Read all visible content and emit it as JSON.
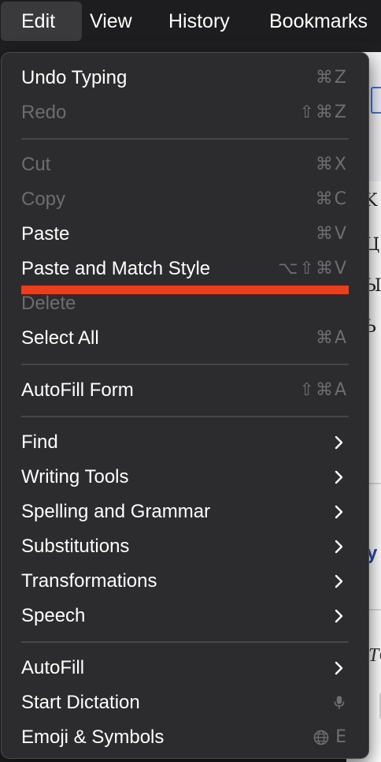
{
  "menubar": {
    "items": [
      {
        "label": "Edit",
        "active": true
      },
      {
        "label": "View"
      },
      {
        "label": "History"
      },
      {
        "label": "Bookmarks"
      }
    ]
  },
  "menu": {
    "items": [
      {
        "label": "Undo Typing",
        "shortcut": "⌘Z",
        "enabled": true
      },
      {
        "label": "Redo",
        "shortcut": "⇧⌘Z",
        "enabled": false
      },
      {
        "label": "Cut",
        "shortcut": "⌘X",
        "enabled": false
      },
      {
        "label": "Copy",
        "shortcut": "⌘C",
        "enabled": false
      },
      {
        "label": "Paste",
        "shortcut": "⌘V",
        "enabled": true
      },
      {
        "label": "Paste and Match Style",
        "shortcut": "⌥⇧⌘V",
        "enabled": true,
        "annotated": true
      },
      {
        "label": "Delete",
        "shortcut": "",
        "enabled": false
      },
      {
        "label": "Select All",
        "shortcut": "⌘A",
        "enabled": true
      },
      {
        "label": "AutoFill Form",
        "shortcut": "⇧⌘A",
        "enabled": true
      },
      {
        "label": "Find",
        "submenu": true,
        "enabled": true
      },
      {
        "label": "Writing Tools",
        "submenu": true,
        "enabled": true
      },
      {
        "label": "Spelling and Grammar",
        "submenu": true,
        "enabled": true
      },
      {
        "label": "Substitutions",
        "submenu": true,
        "enabled": true
      },
      {
        "label": "Transformations",
        "submenu": true,
        "enabled": true
      },
      {
        "label": "Speech",
        "submenu": true,
        "enabled": true
      },
      {
        "label": "AutoFill",
        "submenu": true,
        "enabled": true
      },
      {
        "label": "Start Dictation",
        "shortcut_icon": "microphone-icon",
        "enabled": true
      },
      {
        "label": "Emoji & Symbols",
        "shortcut": "E",
        "shortcut_icon": "globe-icon",
        "enabled": true
      }
    ]
  },
  "colors": {
    "menu_bg": "#2c2c2e",
    "annotation": "#e8401f",
    "disabled_text": "#6d6d70",
    "shortcut_text": "#6e6e71"
  },
  "background": {
    "glyphs": [
      "K",
      "Ц",
      "Ы",
      "Ь"
    ],
    "blue_text": "y",
    "italic_text": "TC"
  }
}
